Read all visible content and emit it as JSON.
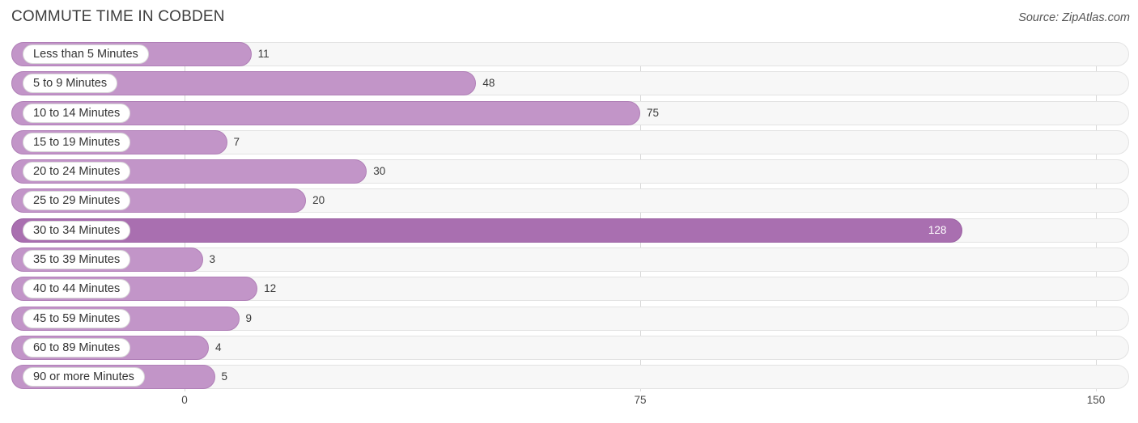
{
  "header": {
    "title": "Commute Time in Cobden",
    "source": "Source: ZipAtlas.com"
  },
  "chart_data": {
    "type": "bar",
    "orientation": "horizontal",
    "title": "COMMUTE TIME IN COBDEN",
    "subtitle": "",
    "xlabel": "",
    "ylabel": "",
    "xlim": [
      0,
      150
    ],
    "ticks": [
      0,
      75,
      150
    ],
    "tick_labels": [
      "0",
      "75",
      "150"
    ],
    "grid": true,
    "legend": null,
    "categories": [
      "Less than 5 Minutes",
      "5 to 9 Minutes",
      "10 to 14 Minutes",
      "15 to 19 Minutes",
      "20 to 24 Minutes",
      "25 to 29 Minutes",
      "30 to 34 Minutes",
      "35 to 39 Minutes",
      "40 to 44 Minutes",
      "45 to 59 Minutes",
      "60 to 89 Minutes",
      "90 or more Minutes"
    ],
    "values": [
      11,
      48,
      75,
      7,
      30,
      20,
      128,
      3,
      12,
      9,
      4,
      5
    ],
    "value_labels": [
      "11",
      "48",
      "75",
      "7",
      "30",
      "20",
      "128",
      "3",
      "12",
      "9",
      "4",
      "5"
    ],
    "colors": {
      "bar": "#c295c8",
      "bar_highlight": "#a96fb0",
      "track": "#f7f7f7",
      "track_border": "#e3e3e3",
      "gridline": "#d6d6d6",
      "text": "#3d3d3d"
    }
  }
}
